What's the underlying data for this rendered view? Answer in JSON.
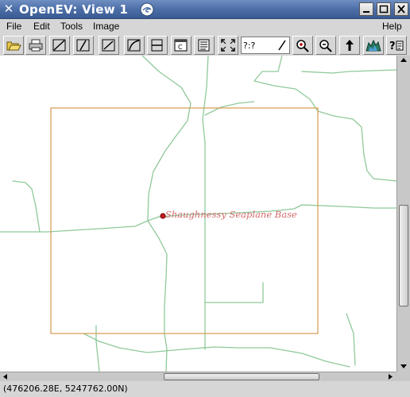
{
  "window": {
    "title": "OpenEV: View 1"
  },
  "titlebar_icons": [
    "close-x-icon",
    "swirl-icon",
    "minimize-icon",
    "maximize-icon",
    "close-icon"
  ],
  "menu": {
    "file": "File",
    "edit": "Edit",
    "tools": "Tools",
    "image": "Image",
    "help": "Help"
  },
  "toolbar": {
    "tools": [
      "open-folder-icon",
      "print-icon",
      "draw-line-icon",
      "draw-polyline-icon",
      "draw-area-icon",
      "edit-vertex-icon",
      "node-tool-icon",
      "roi-tool-icon",
      "text-label-icon",
      "layers-list-icon",
      "fit-extents-icon"
    ],
    "zoom_field_value": "?:?",
    "right_tools": [
      "zoom-in-icon",
      "zoom-out-icon",
      "north-arrow-icon",
      "3d-view-icon",
      "whats-this-help-icon"
    ]
  },
  "map": {
    "label": "Shaughnessy Seaplane Base",
    "colors": {
      "roads": "#8fc99a",
      "extent_box": "#d8a05c",
      "label": "#d36a6a",
      "point": "#c0181e"
    }
  },
  "status": {
    "coordinates": "(476206.28E, 5247762.00N)"
  }
}
